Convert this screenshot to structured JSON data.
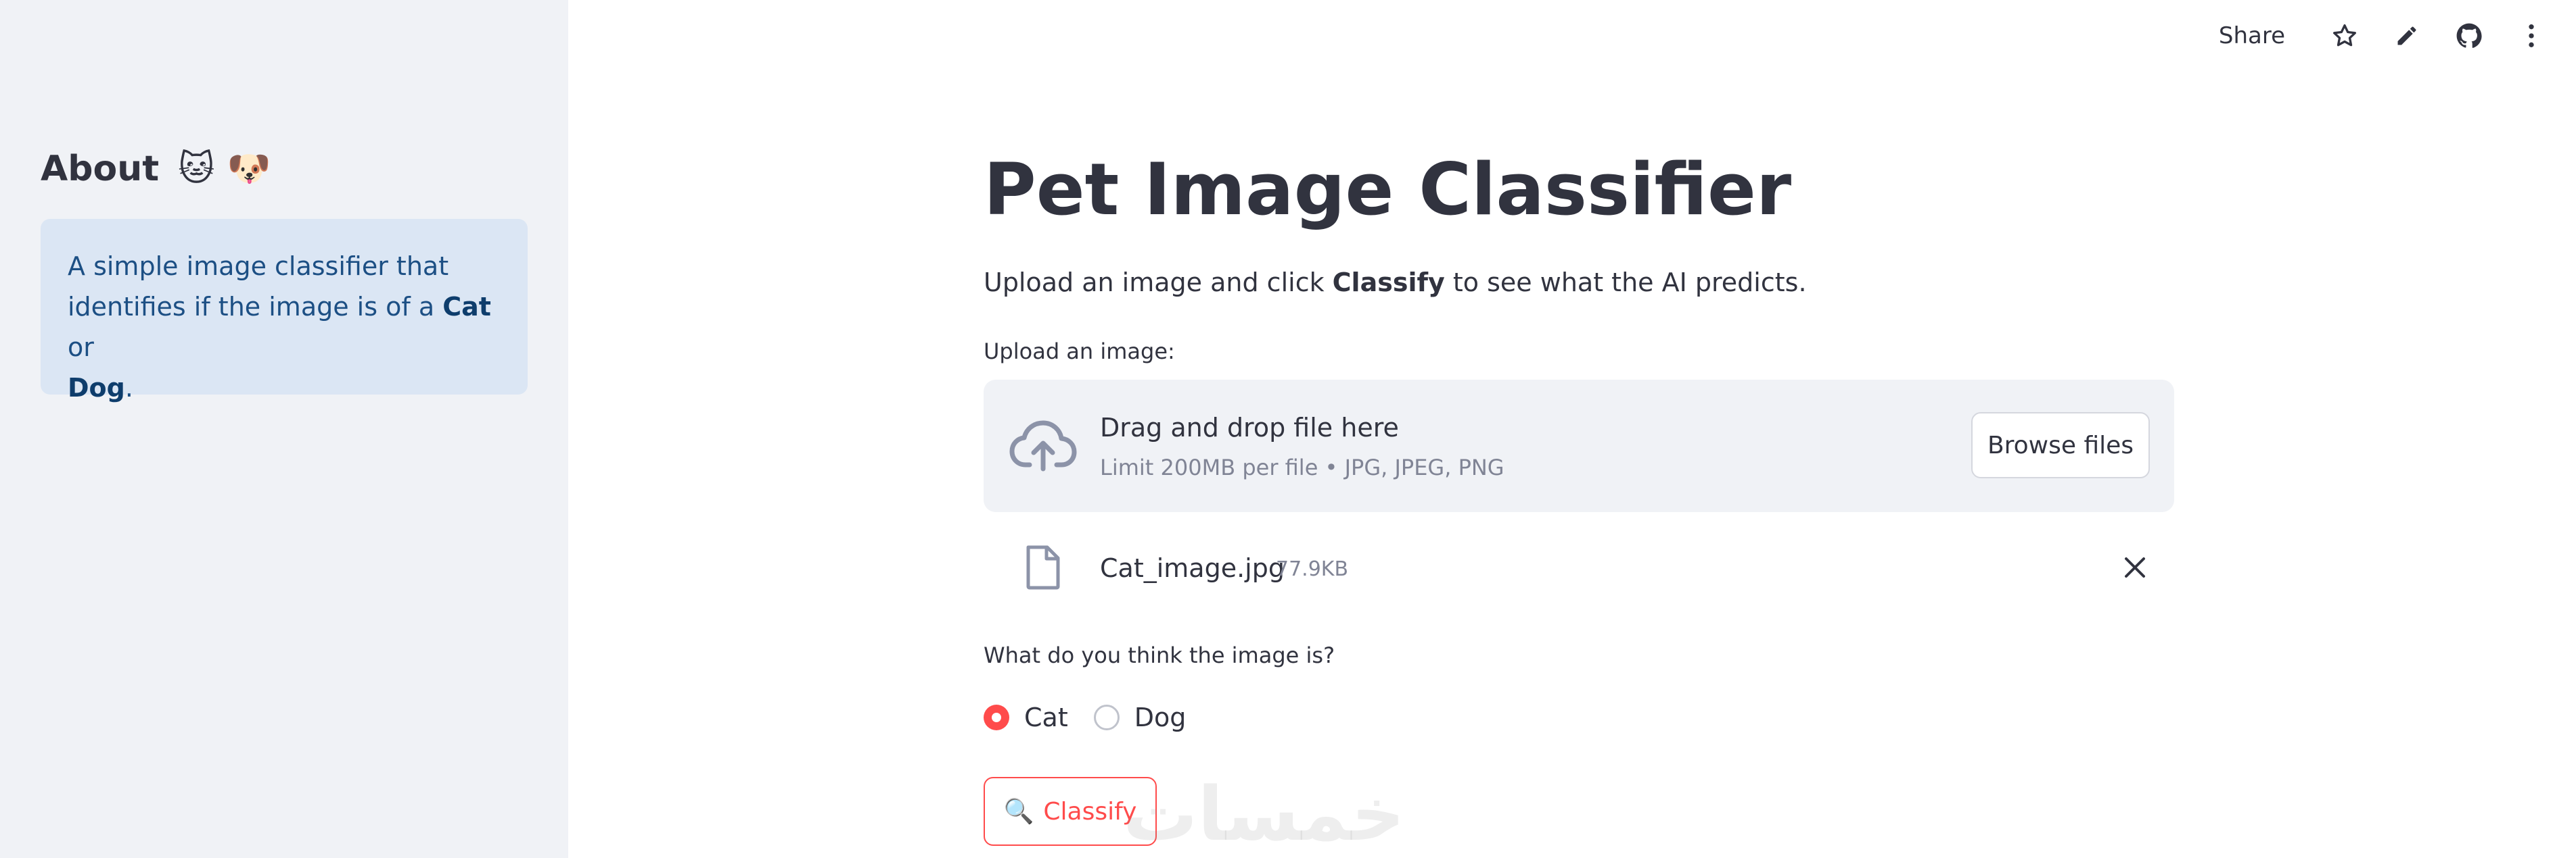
{
  "sidebar": {
    "title": "About",
    "title_emojis": "🐱 🐶",
    "info": {
      "part1": "A simple image classifier that identifies if the image is of a ",
      "bold1": "Cat",
      "part2": " or ",
      "bold2": "Dog",
      "part3": "."
    }
  },
  "toolbar": {
    "share_label": "Share",
    "icons": [
      "star-icon",
      "pencil-icon",
      "github-icon",
      "more-vertical-icon"
    ]
  },
  "main": {
    "title": "Pet Image Classifier",
    "subtitle": {
      "before": "Upload an image and click ",
      "bold": "Classify",
      "after": " to see what the AI predicts."
    },
    "upload_label": "Upload an image:",
    "dropzone": {
      "title": "Drag and drop file here",
      "limit": "Limit 200MB per file • JPG, JPEG, PNG",
      "browse_label": "Browse files"
    },
    "file": {
      "name": "Cat_image.jpg",
      "size": "77.9KB"
    },
    "question": "What do you think the image is?",
    "options": [
      {
        "label": "Cat",
        "selected": true
      },
      {
        "label": "Dog",
        "selected": false
      }
    ],
    "classify_icon": "🔍",
    "classify_label": "Classify",
    "watermark": "خمسات"
  },
  "colors": {
    "accent": "#ff4b4b",
    "sidebar_bg": "#f0f2f6",
    "info_bg": "#dbe6f4",
    "info_text": "#1c4f84",
    "text": "#31333f",
    "muted": "#808495"
  }
}
